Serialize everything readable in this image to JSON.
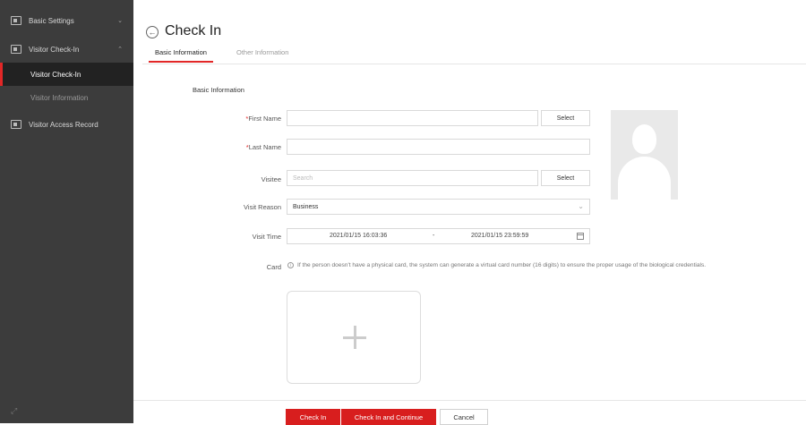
{
  "sidebar": {
    "groups": [
      {
        "label": "Basic Settings",
        "icon": "settings-icon",
        "expanded": false
      },
      {
        "label": "Visitor Check-In",
        "icon": "visitor-checkin-icon",
        "expanded": true
      },
      {
        "label": "Visitor Access Record",
        "icon": "access-record-icon"
      }
    ],
    "subitems": [
      {
        "label": "Visitor Check-In",
        "active": true
      },
      {
        "label": "Visitor Information",
        "active": false
      }
    ],
    "bottom_glyph": "⤢"
  },
  "header": {
    "back_glyph": "←",
    "title": "Check In",
    "tabs": [
      {
        "label": "Basic Information",
        "active": true
      },
      {
        "label": "Other Information",
        "active": false
      }
    ]
  },
  "form": {
    "section_title": "Basic Information",
    "first_name": {
      "required_mark": "*",
      "label": "First Name",
      "value": "",
      "select_label": "Select"
    },
    "last_name": {
      "required_mark": "*",
      "label": "Last Name",
      "value": ""
    },
    "visitee": {
      "label": "Visitee",
      "placeholder": "Search",
      "select_label": "Select"
    },
    "visit_reason": {
      "label": "Visit Reason",
      "value": "Business",
      "chevron": "⌄"
    },
    "visit_time": {
      "label": "Visit Time",
      "start": "2021/01/15 16:03:36",
      "separator": "-",
      "end": "2021/01/15 23:59:59"
    },
    "card": {
      "label": "Card",
      "info_glyph": "i",
      "note": "If the person doesn't have a physical card, the system can generate a virtual card number (16 digits) to ensure the proper usage of the biological credentials."
    }
  },
  "footer": {
    "check_in": "Check In",
    "check_in_continue": "Check In and Continue",
    "cancel": "Cancel"
  },
  "colors": {
    "accent": "#d81e1e",
    "sidebar": "#3c3c3c",
    "sidebar_active": "#222222"
  }
}
